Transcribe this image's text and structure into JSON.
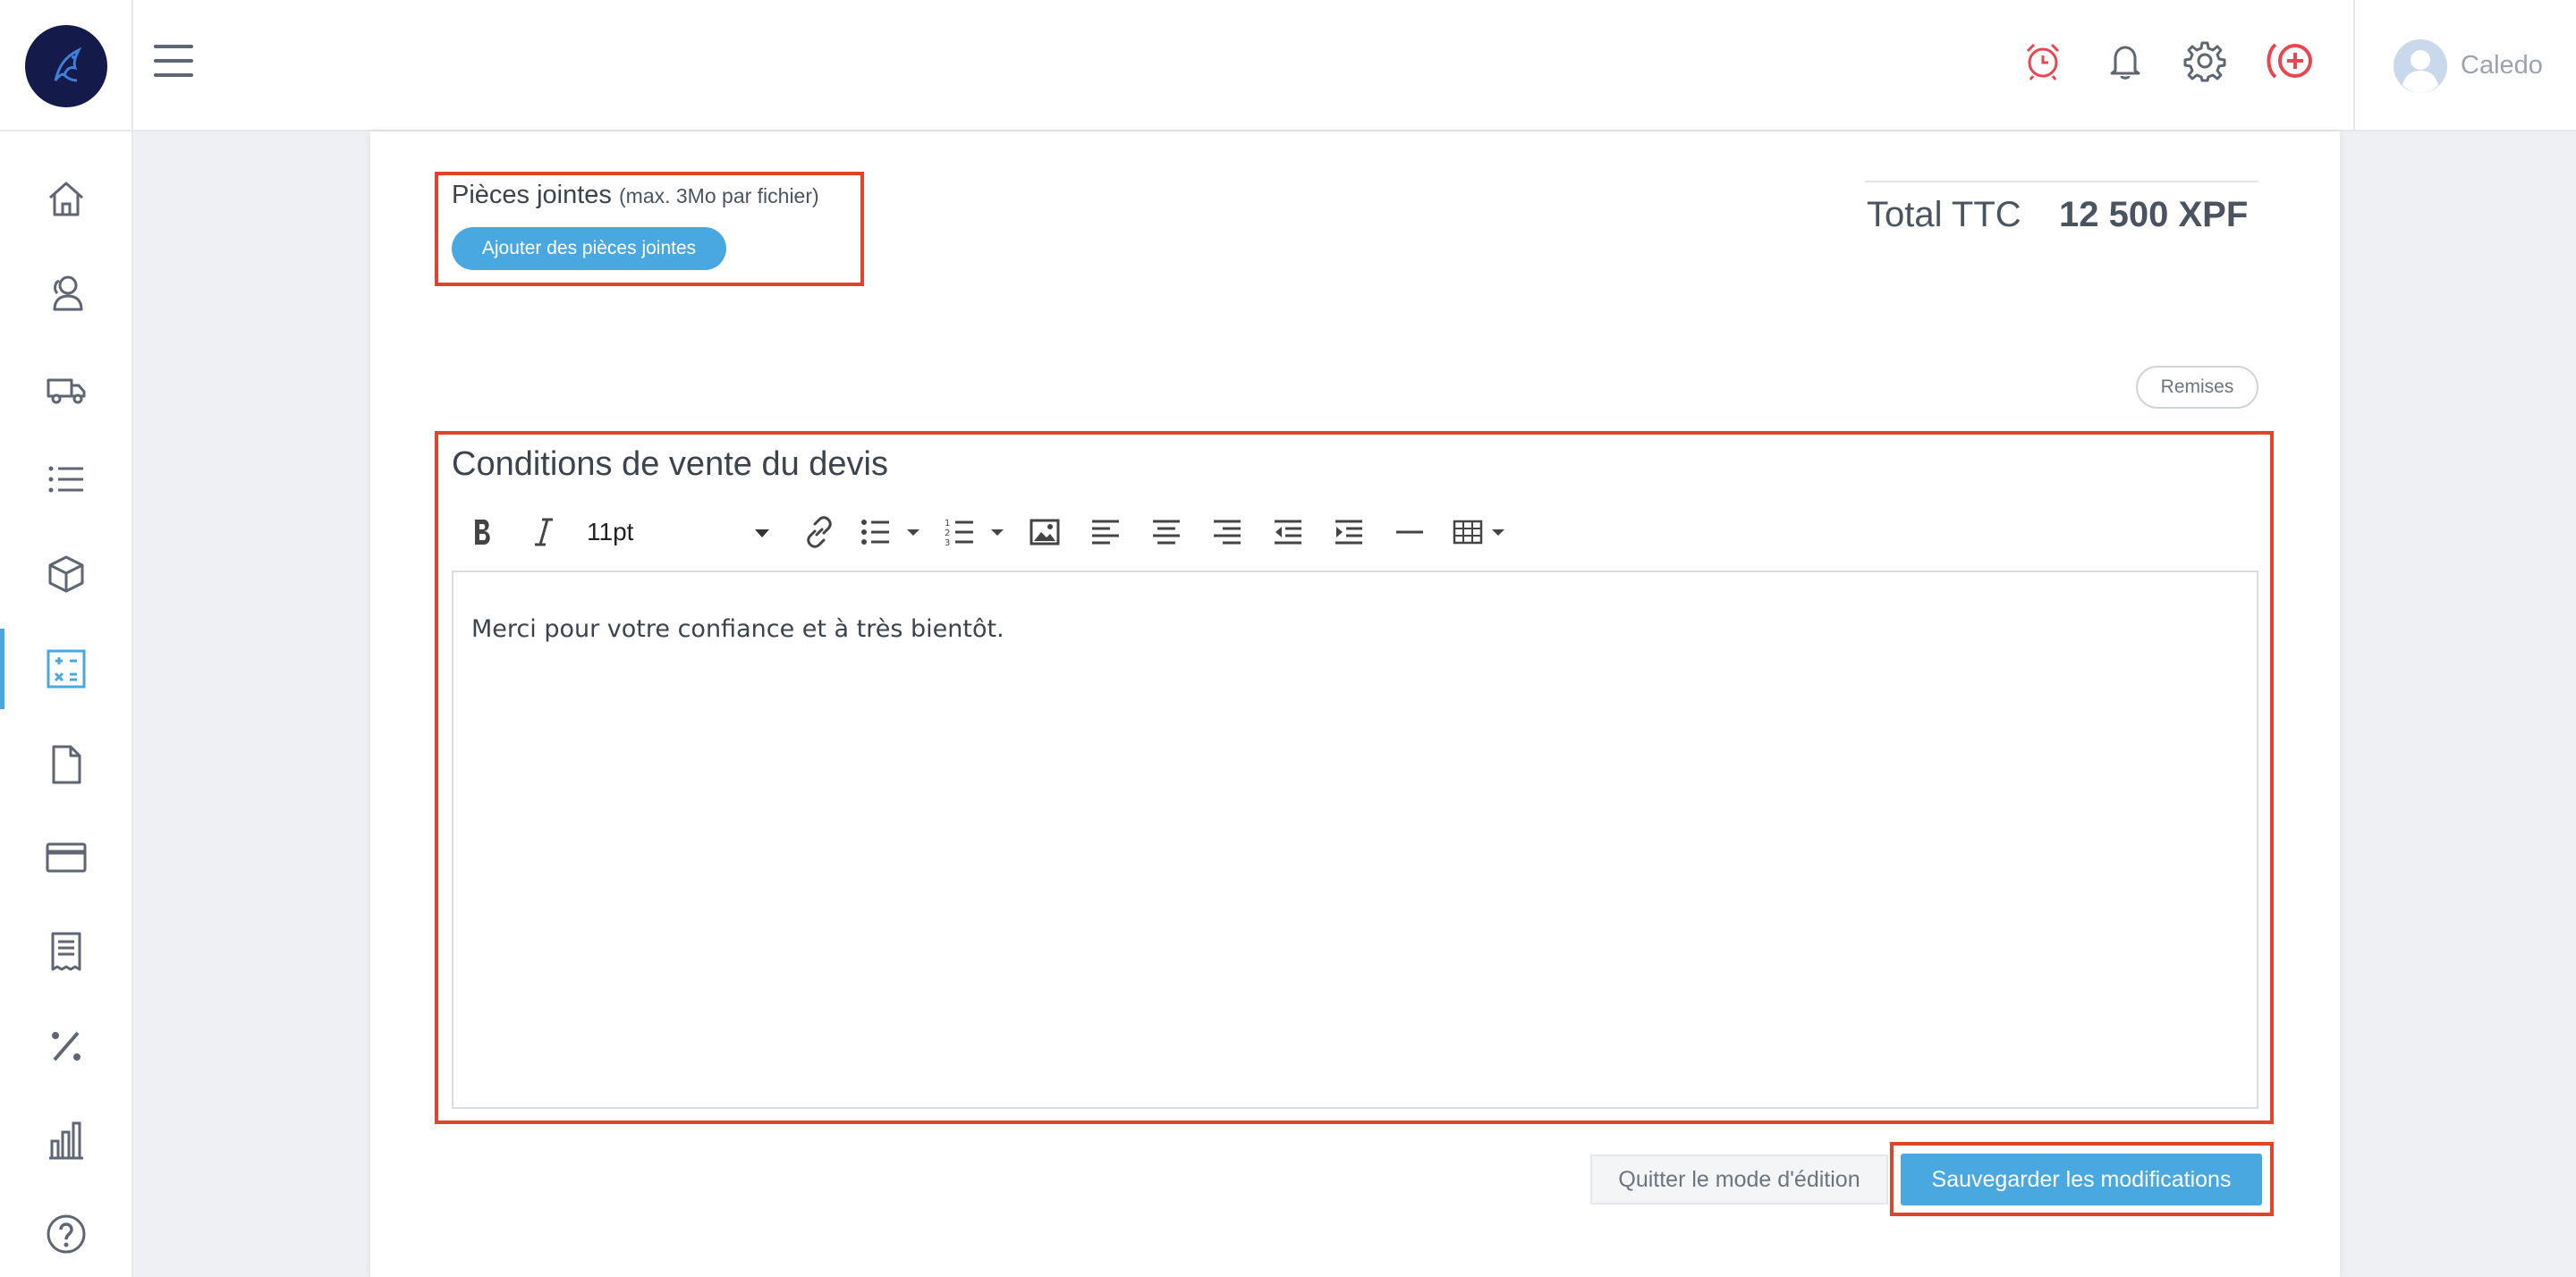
{
  "header": {
    "user_name": "Caledo",
    "icons": [
      "alarm-clock-icon",
      "bell-icon",
      "gear-icon",
      "add-circle-icon"
    ],
    "accent_color": "#e8474f"
  },
  "sidebar": {
    "items": [
      {
        "name": "home-icon"
      },
      {
        "name": "contacts-icon"
      },
      {
        "name": "truck-icon"
      },
      {
        "name": "list-icon"
      },
      {
        "name": "box-icon"
      },
      {
        "name": "calculator-icon",
        "active": true
      },
      {
        "name": "document-icon"
      },
      {
        "name": "credit-card-icon"
      },
      {
        "name": "receipt-icon"
      },
      {
        "name": "percent-icon"
      },
      {
        "name": "bar-chart-icon"
      },
      {
        "name": "help-icon"
      }
    ],
    "active_color": "#4aa8e0"
  },
  "attachments": {
    "title": "Pièces jointes",
    "note": "(max. 3Mo par fichier)",
    "button_label": "Ajouter des pièces jointes"
  },
  "totals": {
    "label": "Total TTC",
    "value": "12 500 XPF"
  },
  "discount_button": "Remises",
  "conditions": {
    "title": "Conditions de vente du devis",
    "font_size": "11pt",
    "content": "Merci pour votre confiance et à très bientôt."
  },
  "actions": {
    "quit_label": "Quitter le mode d'édition",
    "save_label": "Sauvegarder les modifications"
  },
  "colors": {
    "primary": "#4aa8e0",
    "highlight": "#e0452a"
  }
}
